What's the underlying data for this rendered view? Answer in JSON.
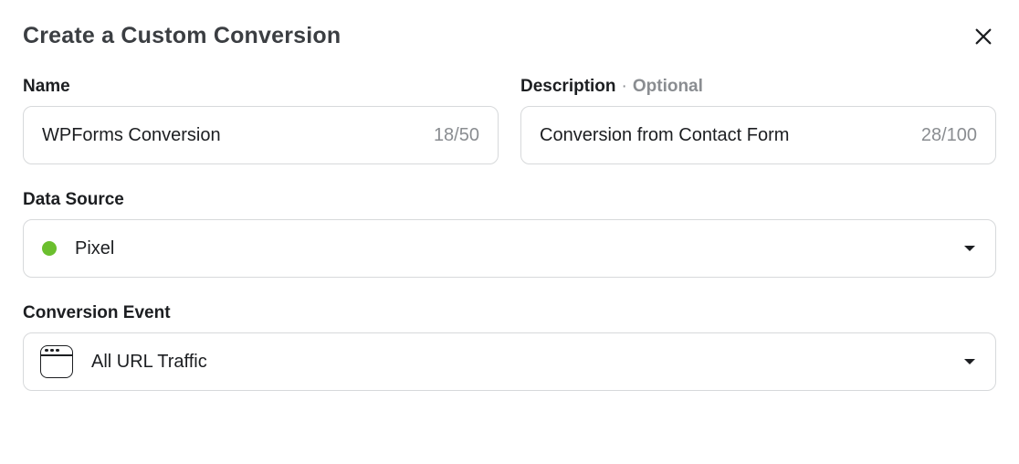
{
  "header": {
    "title": "Create a Custom Conversion"
  },
  "name": {
    "label": "Name",
    "value": "WPForms Conversion",
    "counter": "18/50"
  },
  "description": {
    "label": "Description",
    "separator": "·",
    "optional": "Optional",
    "value": "Conversion from Contact Form",
    "counter": "28/100"
  },
  "data_source": {
    "label": "Data Source",
    "selected": "Pixel"
  },
  "conversion_event": {
    "label": "Conversion Event",
    "selected": "All URL Traffic"
  }
}
